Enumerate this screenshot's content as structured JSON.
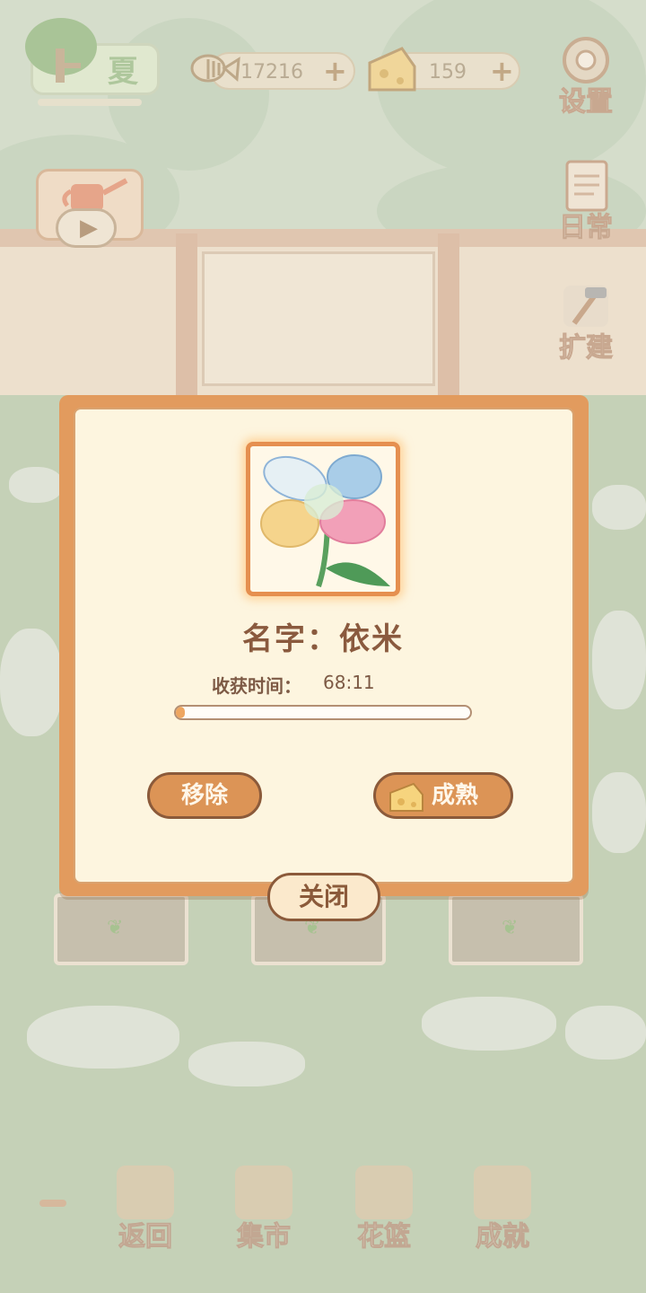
{
  "hud": {
    "season": "夏",
    "fish_currency": "17216",
    "cheese_currency": "159",
    "plus": "+"
  },
  "side_menu": {
    "settings": "设置",
    "daily": "日常",
    "expand": "扩建"
  },
  "dialog": {
    "name_label": "名字：依米",
    "harvest_label": "收获时间：",
    "harvest_time": "68:11",
    "progress": 0.02,
    "remove_button": "移除",
    "ripen_button": "成熟",
    "close_button": "关闭"
  },
  "bottom_nav": {
    "back": "返回",
    "market": "集市",
    "basket": "花篮",
    "achievements": "成就"
  },
  "colors": {
    "dialog_border": "#e29b5e",
    "dialog_bg": "#fdf5df",
    "button_fill": "#dc9456",
    "text_brown": "#8a5a3e",
    "progress_fill": "#eea660"
  }
}
